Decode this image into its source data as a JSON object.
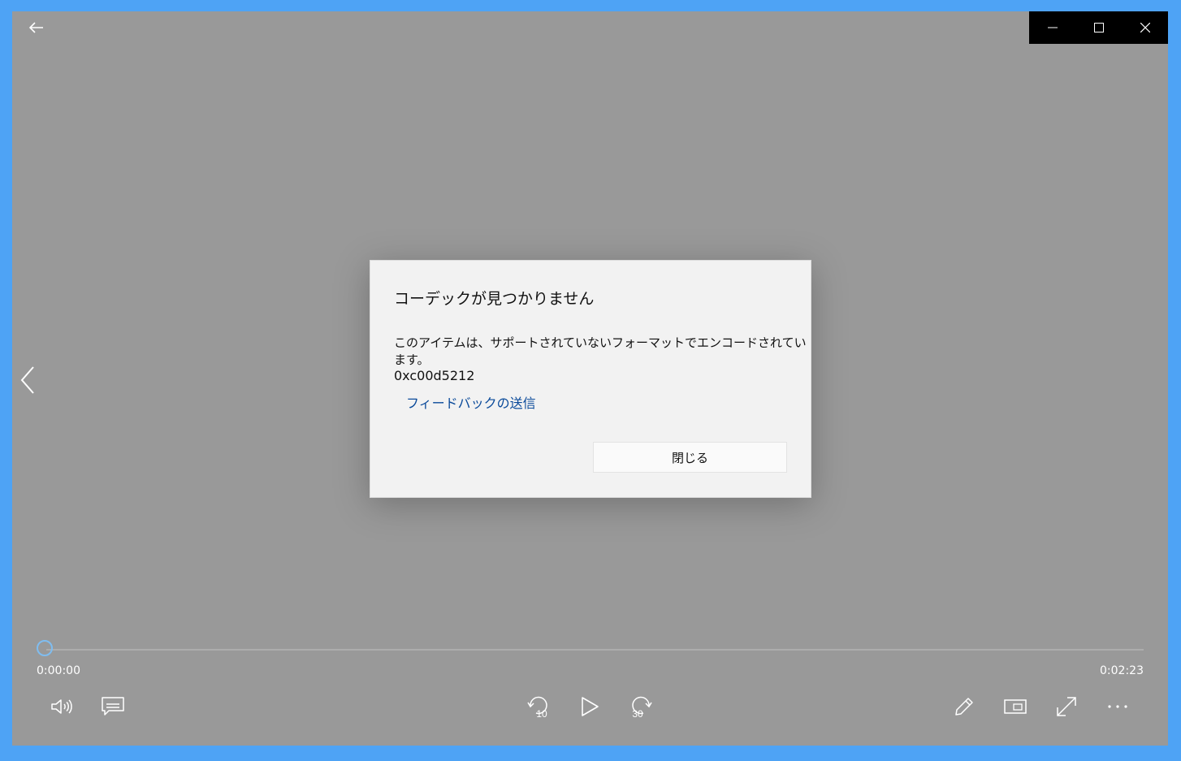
{
  "dialog": {
    "title": "コーデックが見つかりません",
    "message": "このアイテムは、サポートされていないフォーマットでエンコードされています。",
    "error_code": "0xc00d5212",
    "feedback_link": "フィードバックの送信",
    "close_button": "閉じる"
  },
  "player": {
    "current_time": "0:00:00",
    "total_time": "0:02:23",
    "progress": 0,
    "skip_back_seconds": "10",
    "skip_forward_seconds": "30"
  },
  "icons": {
    "back": "back-arrow-icon",
    "minimize": "minimize-icon",
    "maximize": "maximize-icon",
    "close": "close-icon",
    "previous": "chevron-left-icon",
    "volume": "volume-icon",
    "subtitles": "subtitles-icon",
    "skip_back": "skip-back-icon",
    "play": "play-icon",
    "skip_forward": "skip-forward-icon",
    "edit": "pencil-icon",
    "mini_view": "mini-view-icon",
    "fullscreen": "fullscreen-icon",
    "more": "more-icon"
  },
  "colors": {
    "desktop": "#4ea3f5",
    "player_bg": "#999999",
    "dialog_bg": "#f2f2f2",
    "link": "#0a4a9a",
    "seek_thumb": "#7fbdf0"
  }
}
